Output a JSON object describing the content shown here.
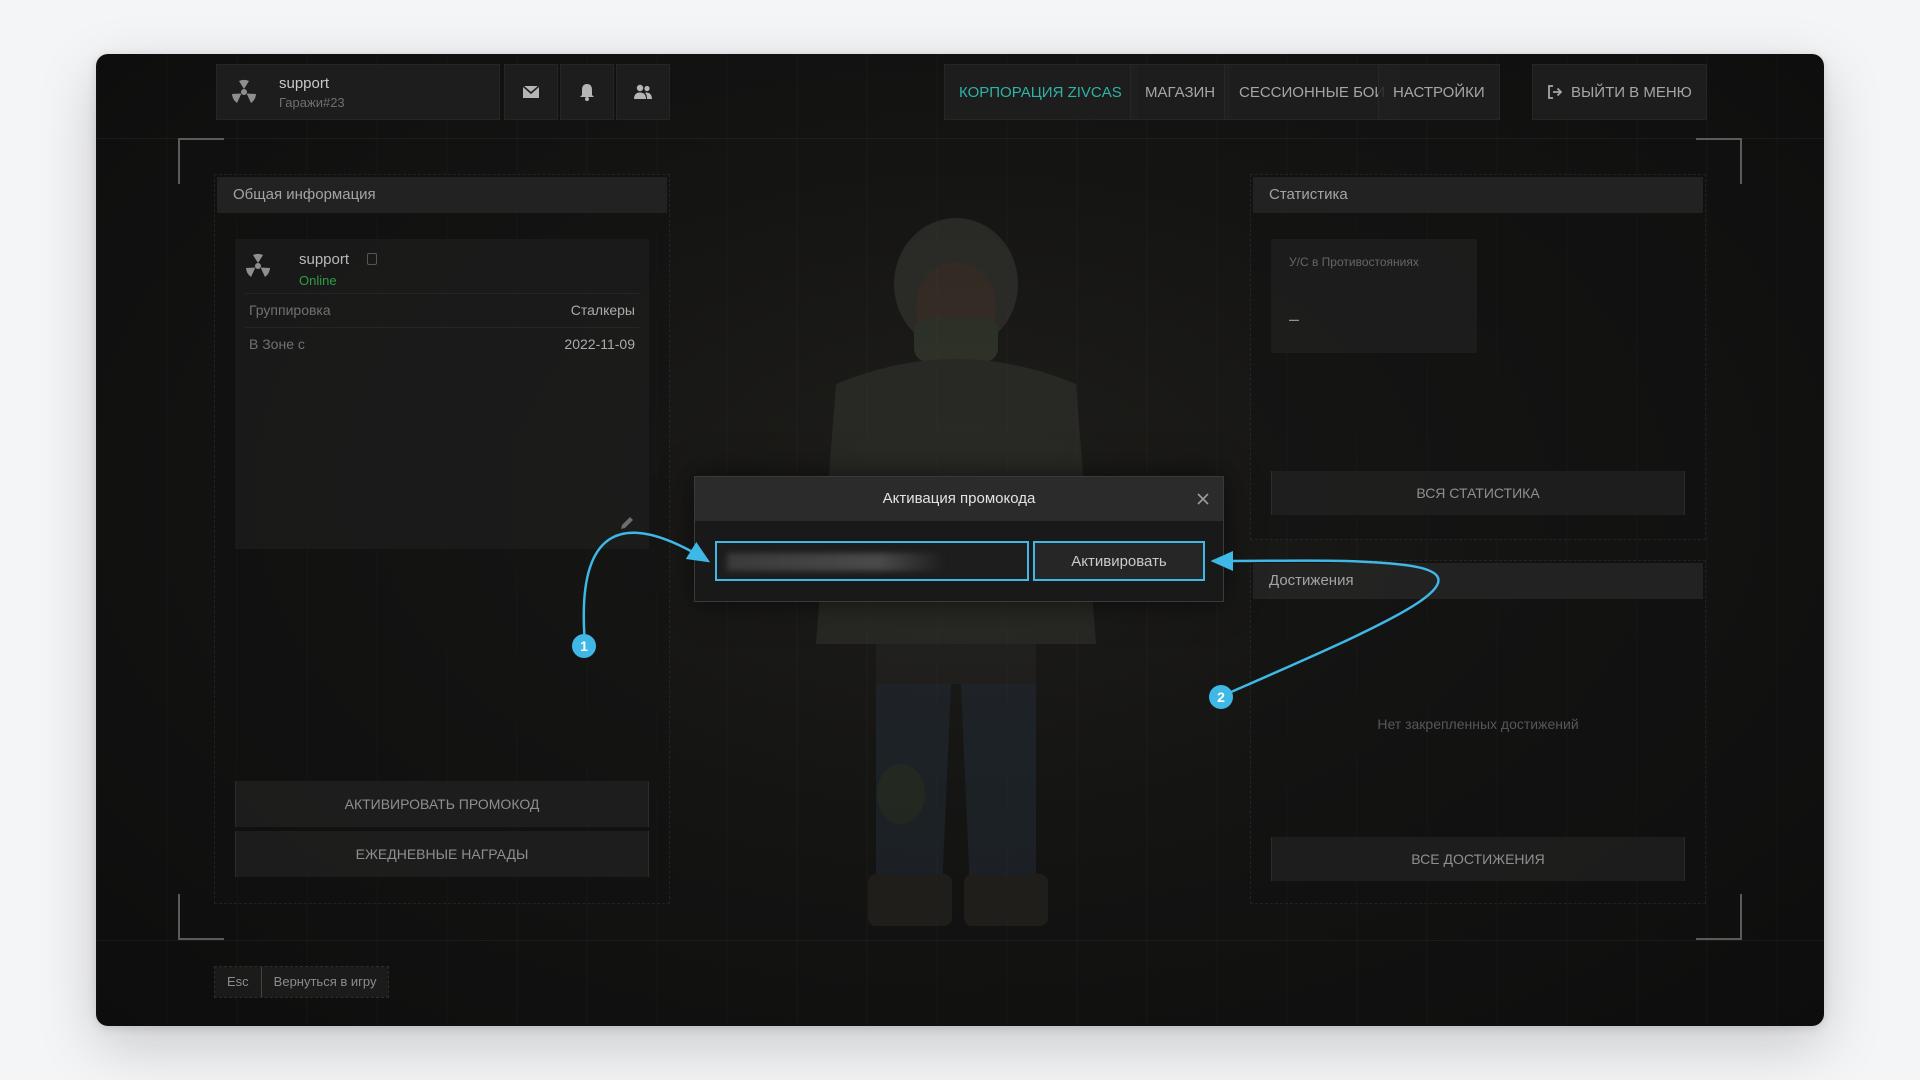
{
  "user": {
    "name": "support",
    "location": "Гаражи#23"
  },
  "nav": {
    "items": [
      {
        "label": "КОРПОРАЦИЯ ZIVCAS",
        "active": true
      },
      {
        "label": "МАГАЗИН",
        "active": false
      },
      {
        "label": "СЕССИОННЫЕ БОИ",
        "active": false
      },
      {
        "label": "НАСТРОЙКИ",
        "active": false
      }
    ],
    "logout_label": "ВЫЙТИ В МЕНЮ"
  },
  "info_panel": {
    "title": "Общая информация",
    "name": "support",
    "status": "Online",
    "rows": [
      {
        "key": "Группировка",
        "value": "Сталкеры"
      },
      {
        "key": "В Зоне с",
        "value": "2022-11-09"
      }
    ],
    "promo_button": "АКТИВИРОВАТЬ ПРОМОКОД",
    "daily_button": "ЕЖЕДНЕВНЫЕ НАГРАДЫ"
  },
  "stats_panel": {
    "title": "Статистика",
    "card_label": "У/С в Противостояниях",
    "card_value": "–",
    "all_button": "ВСЯ СТАТИСТИКА"
  },
  "achievements_panel": {
    "title": "Достижения",
    "empty_text": "Нет закрепленных достижений",
    "all_button": "ВСЕ ДОСТИЖЕНИЯ"
  },
  "modal": {
    "title": "Активация промокода",
    "input_value": "",
    "activate_label": "Активировать"
  },
  "annotations": {
    "badge1": "1",
    "badge2": "2"
  },
  "footer": {
    "esc_key": "Esc",
    "return_label": "Вернуться в игру"
  },
  "colors": {
    "accent": "#3fb8e6",
    "active_nav": "#2fb3a6",
    "online": "#2f9e44"
  }
}
